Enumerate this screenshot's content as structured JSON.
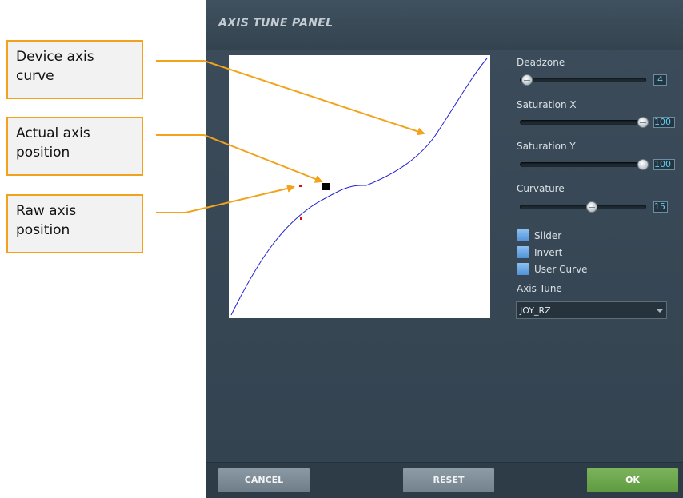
{
  "callouts": {
    "device_axis_curve": "Device axis\ncurve",
    "actual_axis_position": "Actual axis\nposition",
    "raw_axis_position": "Raw axis\nposition"
  },
  "panel": {
    "title": "AXIS TUNE PANEL"
  },
  "controls": {
    "deadzone": {
      "label": "Deadzone",
      "value": "4"
    },
    "saturation_x": {
      "label": "Saturation X",
      "value": "100"
    },
    "saturation_y": {
      "label": "Saturation Y",
      "value": "100"
    },
    "curvature": {
      "label": "Curvature",
      "value": "15"
    }
  },
  "checkboxes": {
    "slider": "Slider",
    "invert": "Invert",
    "user_curve": "User Curve"
  },
  "axis_tune": {
    "label": "Axis Tune",
    "selected": "JOY_RZ"
  },
  "footer": {
    "cancel": "CANCEL",
    "reset": "RESET",
    "ok": "OK"
  },
  "colors": {
    "accent_orange": "#f2a31b",
    "panel_bg": "#3a4a58",
    "ok_green": "#6aa84a",
    "value_text": "#5fd0f0",
    "curve_blue": "#1f1fd6",
    "marker_red": "#e01010"
  }
}
